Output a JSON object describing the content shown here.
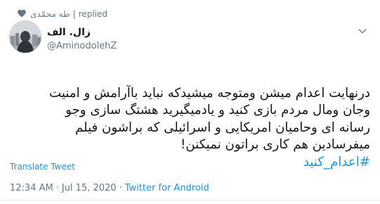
{
  "reply_context": {
    "display_name": "طه محمّدی",
    "separator": "|",
    "status_label": "replied"
  },
  "author": {
    "display_name": "زال. الف",
    "handle": "@AminodolehZ"
  },
  "tweet": {
    "text": "درنهایت اعدام میشن ومتوجه میشیدکه  نباید باآرامش و امنیت\nوجان ومال مردم بازی کنید و یادمیگیرید هشتگ سازی وجو\nرسانه ای وحامیان امریکایی و اسرائیلی که براشون فیلم\nمیفرسادین هم کاری براتون نمیکنن!",
    "hashtag": "#اعدام_کنید"
  },
  "actions": {
    "translate_label": "Translate Tweet"
  },
  "meta": {
    "time": "12:34 AM",
    "dot": "·",
    "date": "Jul 15, 2020",
    "client": "Twitter for Android"
  },
  "colors": {
    "link": "#1b95e0",
    "muted": "#657786",
    "text": "#14171a"
  },
  "icons": {
    "liked": "heart-icon",
    "menu": "chevron-down-icon"
  }
}
